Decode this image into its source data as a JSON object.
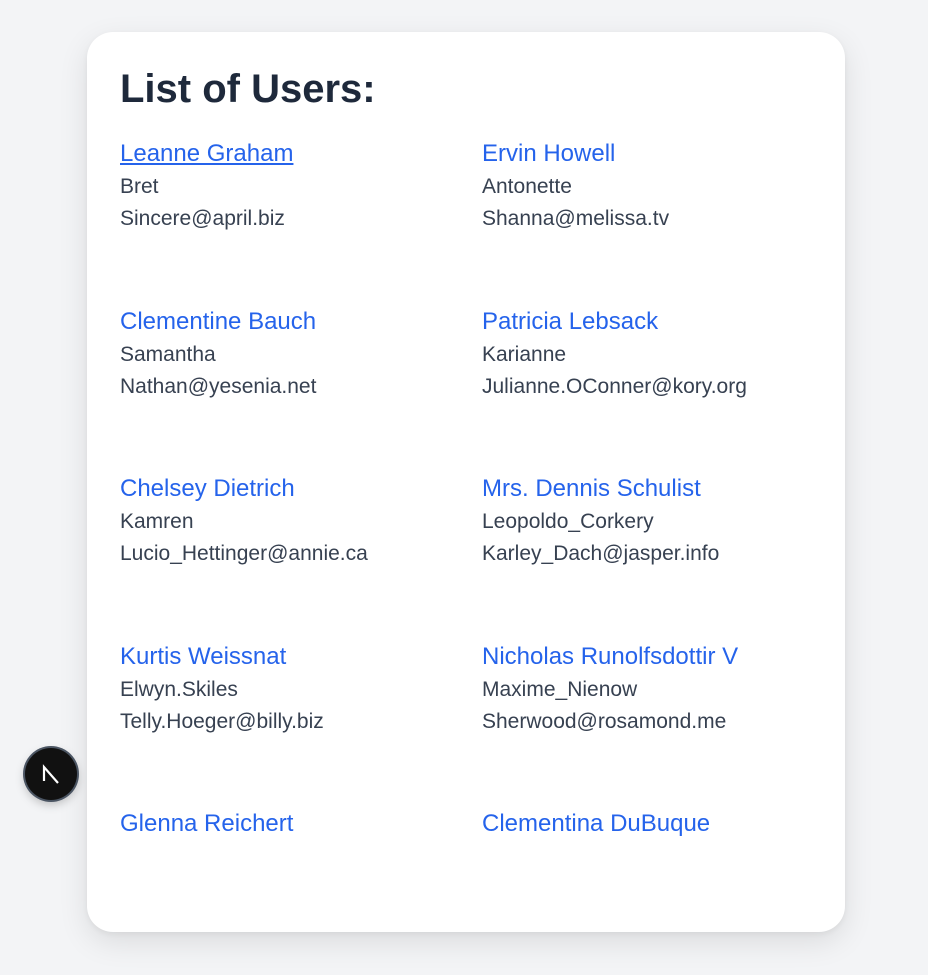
{
  "page": {
    "title": "List of Users:"
  },
  "users": [
    {
      "name": "Leanne Graham",
      "username": "Bret",
      "email": "Sincere@april.biz"
    },
    {
      "name": "Ervin Howell",
      "username": "Antonette",
      "email": "Shanna@melissa.tv"
    },
    {
      "name": "Clementine Bauch",
      "username": "Samantha",
      "email": "Nathan@yesenia.net"
    },
    {
      "name": "Patricia Lebsack",
      "username": "Karianne",
      "email": "Julianne.OConner@kory.org"
    },
    {
      "name": "Chelsey Dietrich",
      "username": "Kamren",
      "email": "Lucio_Hettinger@annie.ca"
    },
    {
      "name": "Mrs. Dennis Schulist",
      "username": "Leopoldo_Corkery",
      "email": "Karley_Dach@jasper.info"
    },
    {
      "name": "Kurtis Weissnat",
      "username": "Elwyn.Skiles",
      "email": "Telly.Hoeger@billy.biz"
    },
    {
      "name": "Nicholas Runolfsdottir V",
      "username": "Maxime_Nienow",
      "email": "Sherwood@rosamond.me"
    },
    {
      "name": "Glenna Reichert",
      "username": "",
      "email": ""
    },
    {
      "name": "Clementina DuBuque",
      "username": "",
      "email": ""
    }
  ],
  "colors": {
    "link": "#2563eb",
    "text": "#374151",
    "heading": "#1e293b",
    "background": "#f3f4f6",
    "card": "#ffffff"
  },
  "dev_indicator": {
    "icon": "nextjs-n-icon"
  }
}
